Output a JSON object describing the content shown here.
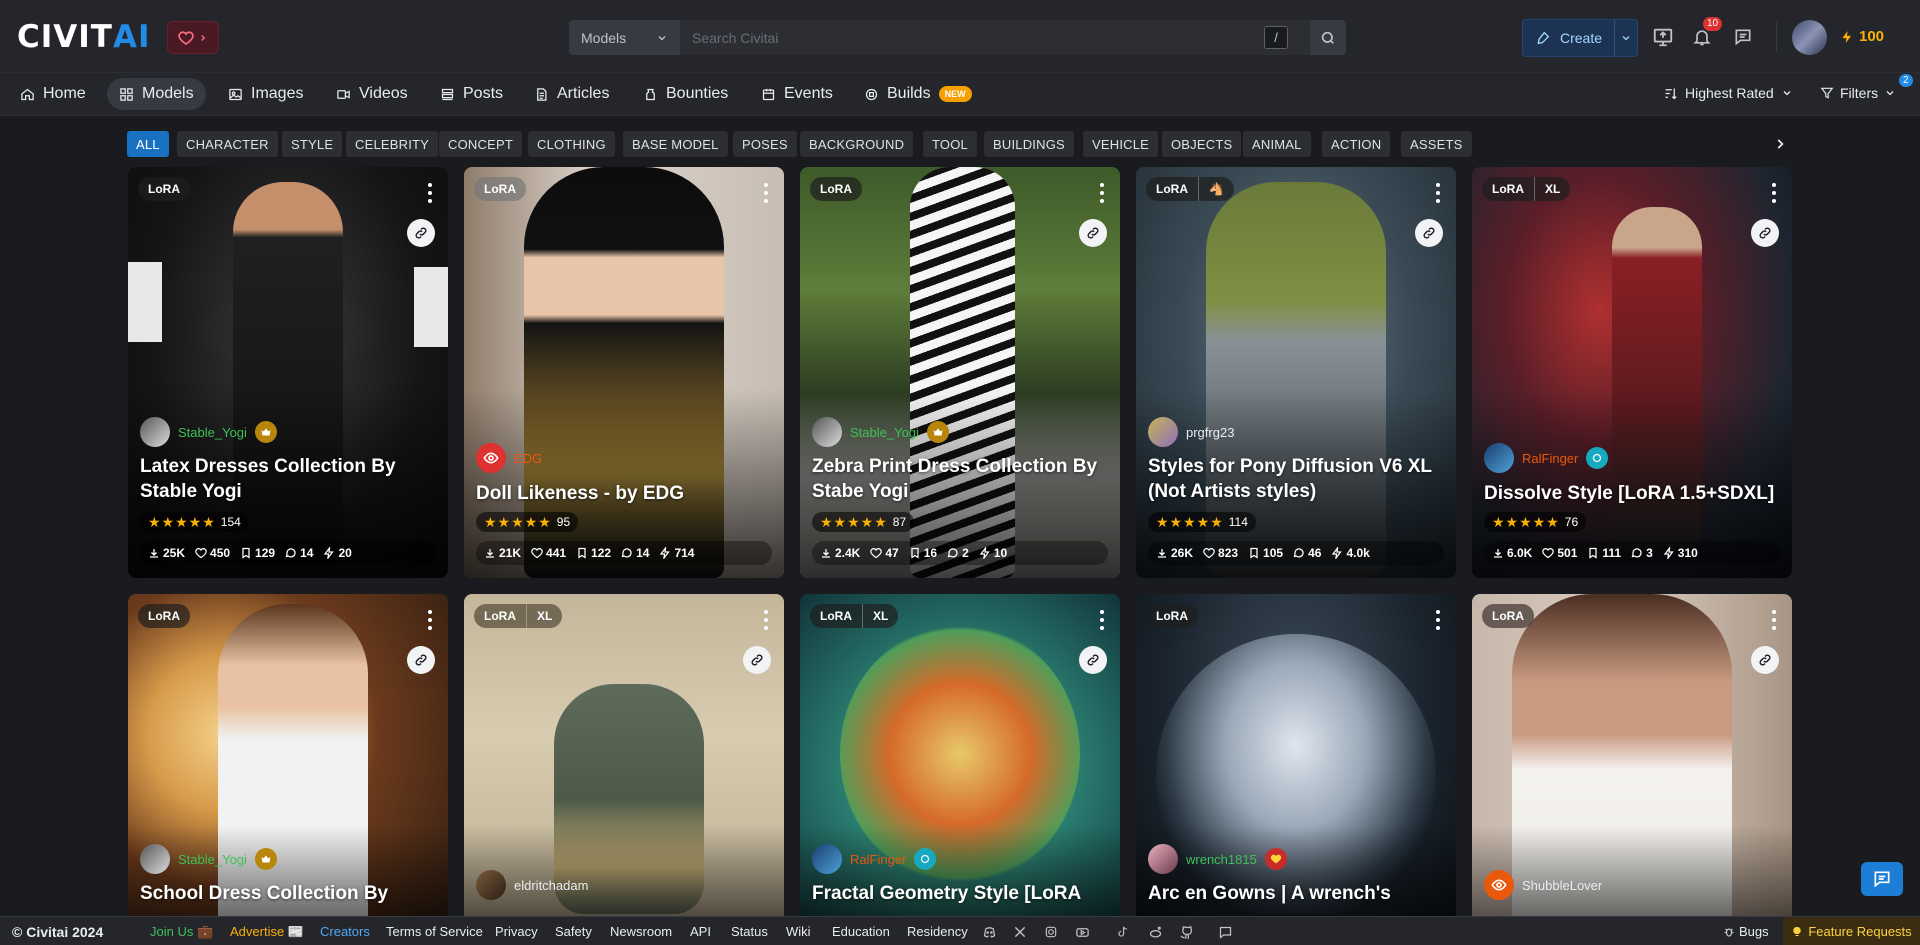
{
  "brand": {
    "logo_left": "CIVIT",
    "logo_right": "AI"
  },
  "search": {
    "scope": "Models",
    "placeholder": "Search Civitai",
    "shortcut": "/"
  },
  "header": {
    "create_label": "Create",
    "notifications_count": "10",
    "buzz_amount": "100"
  },
  "nav": {
    "items": [
      {
        "label": "Home",
        "icon": "home-icon"
      },
      {
        "label": "Models",
        "icon": "grid-icon"
      },
      {
        "label": "Images",
        "icon": "image-icon"
      },
      {
        "label": "Videos",
        "icon": "video-icon"
      },
      {
        "label": "Posts",
        "icon": "posts-icon"
      },
      {
        "label": "Articles",
        "icon": "article-icon"
      },
      {
        "label": "Bounties",
        "icon": "bounty-icon"
      },
      {
        "label": "Events",
        "icon": "calendar-icon"
      },
      {
        "label": "Builds",
        "icon": "cpu-icon",
        "badge": "NEW"
      }
    ],
    "sort_label": "Highest Rated",
    "filters_label": "Filters",
    "filters_count": "2"
  },
  "categories": [
    "ALL",
    "CHARACTER",
    "STYLE",
    "CELEBRITY",
    "CONCEPT",
    "CLOTHING",
    "BASE MODEL",
    "POSES",
    "BACKGROUND",
    "TOOL",
    "BUILDINGS",
    "VEHICLE",
    "OBJECTS",
    "ANIMAL",
    "ACTION",
    "ASSETS"
  ],
  "cards": [
    {
      "badges": [
        "LoRA"
      ],
      "creator": "Stable_Yogi",
      "title": "Latex Dresses Collection By Stable Yogi",
      "rating_count": "154",
      "downloads": "25K",
      "likes": "450",
      "saves": "129",
      "comments": "14",
      "buzz": "20"
    },
    {
      "badges": [
        "LoRA"
      ],
      "creator": "EDG",
      "title": "Doll Likeness - by EDG",
      "rating_count": "95",
      "downloads": "21K",
      "likes": "441",
      "saves": "122",
      "comments": "14",
      "buzz": "714"
    },
    {
      "badges": [
        "LoRA"
      ],
      "creator": "Stable_Yogi",
      "title": "Zebra Print Dress Collection By Stabe Yogi",
      "rating_count": "87",
      "downloads": "2.4K",
      "likes": "47",
      "saves": "16",
      "comments": "2",
      "buzz": "10"
    },
    {
      "badges": [
        "LoRA",
        "🐴"
      ],
      "creator": "prgfrg23",
      "title": "Styles for Pony Diffusion V6 XL (Not Artists styles)",
      "rating_count": "114",
      "downloads": "26K",
      "likes": "823",
      "saves": "105",
      "comments": "46",
      "buzz": "4.0k"
    },
    {
      "badges": [
        "LoRA",
        "XL"
      ],
      "creator": "RalFinger",
      "title": "Dissolve Style [LoRA 1.5+SDXL]",
      "rating_count": "76",
      "downloads": "6.0K",
      "likes": "501",
      "saves": "111",
      "comments": "3",
      "buzz": "310"
    },
    {
      "badges": [
        "LoRA"
      ],
      "creator": "Stable_Yogi",
      "title": "School Dress Collection By"
    },
    {
      "badges": [
        "LoRA",
        "XL"
      ],
      "creator": "eldritchadam",
      "title": ""
    },
    {
      "badges": [
        "LoRA",
        "XL"
      ],
      "creator": "RalFinger",
      "title": "Fractal Geometry Style [LoRA"
    },
    {
      "badges": [
        "LoRA"
      ],
      "creator": "wrench1815",
      "title": "Arc en Gowns | A wrench's"
    },
    {
      "badges": [
        "LoRA"
      ],
      "creator": "ShubbleLover",
      "title": ""
    }
  ],
  "footer": {
    "copyright": "© Civitai 2024",
    "join": "Join Us 💼",
    "advertise": "Advertise 📰",
    "creators": "Creators",
    "terms": "Terms of Service",
    "privacy": "Privacy",
    "safety": "Safety",
    "newsroom": "Newsroom",
    "api": "API",
    "status": "Status",
    "wiki": "Wiki",
    "education": "Education",
    "residency": "Residency",
    "bugs": "Bugs",
    "feature_requests": "Feature Requests"
  },
  "colors": {
    "accent": "#228be6",
    "active_chip": "#1971c2",
    "buzz": "#fab005",
    "new_badge": "#f59f00"
  }
}
